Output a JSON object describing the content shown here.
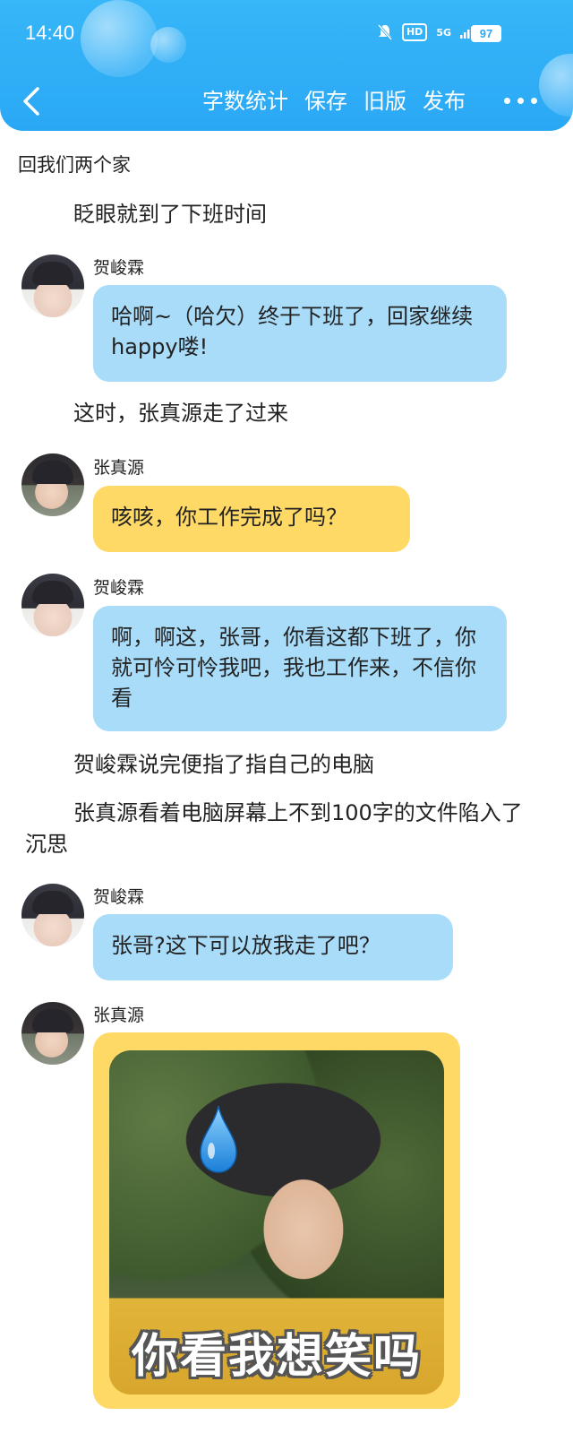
{
  "status_bar": {
    "time": "14:40",
    "hd_label": "HD",
    "signal_label": "5G",
    "battery_level": "97"
  },
  "toolbar": {
    "word_count_label": "字数统计",
    "save_label": "保存",
    "old_version_label": "旧版",
    "publish_label": "发布"
  },
  "colors": {
    "header_blue": "#2aa8f5",
    "bubble_blue": "#a9dcf9",
    "bubble_yellow": "#ffd966"
  },
  "story": {
    "title": "回我们两个家",
    "narration_1": "眨眼就到了下班时间",
    "msg_1": {
      "speaker": "贺峻霖",
      "text": "哈啊~（哈欠）终于下班了，回家继续happy喽!"
    },
    "narration_2": "这时，张真源走了过来",
    "msg_2": {
      "speaker": "张真源",
      "text": "咳咳，你工作完成了吗？"
    },
    "msg_3": {
      "speaker": "贺峻霖",
      "text": "啊，啊这，张哥，你看这都下班了，你就可怜可怜我吧，我也工作来，不信你看"
    },
    "narration_3": "贺峻霖说完便指了指自己的电脑",
    "narration_4": "张真源看着电脑屏幕上不到100字的文件陷入了沉思",
    "msg_4": {
      "speaker": "贺峻霖",
      "text": "张哥?这下可以放我走了吧？"
    },
    "msg_5": {
      "speaker": "张真源",
      "sticker_caption": "你看我想笑吗"
    }
  }
}
